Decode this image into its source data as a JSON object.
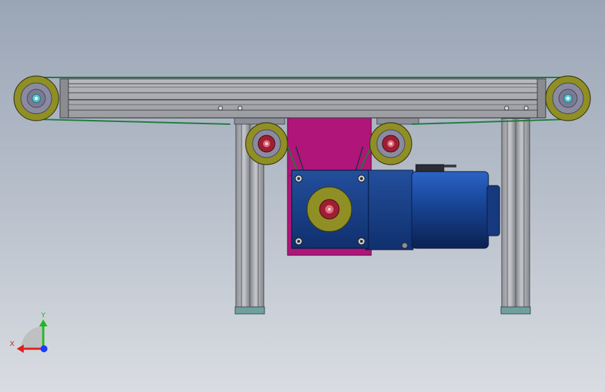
{
  "axis_triad": {
    "x_label": "X",
    "y_label": "Y",
    "x_color": "#e0201c",
    "y_color": "#1fb81f",
    "origin_color": "#1a3cff"
  },
  "colors": {
    "frame_profile": "#a6a8ad",
    "frame_dark": "#55585e",
    "belt": "#1e7a3a",
    "pulley_outer": "#8f8f25",
    "pulley_hub": "#8a8aa0",
    "bearing_cyan": "#56c4d0",
    "idler_red": "#9e1f32",
    "mount_plate": "#b0157a",
    "motor_blue": "#1a3f8c",
    "motor_dark": "#0c2452"
  },
  "parts": [
    "conveyor-frame-profile",
    "drive-belt",
    "head-pulley",
    "tail-pulley",
    "left-idler-roller",
    "right-idler-roller",
    "motor-mount-plate",
    "gearbox",
    "drive-sprocket",
    "electric-motor",
    "left-support-leg",
    "right-support-leg"
  ]
}
